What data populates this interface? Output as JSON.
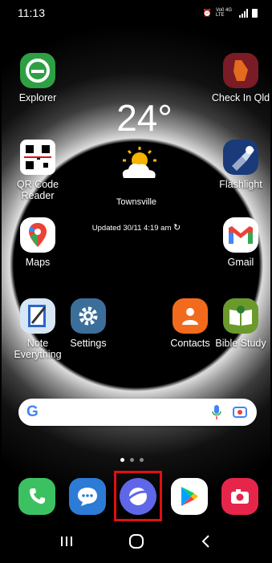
{
  "status": {
    "time": "11:13",
    "network_text": "Vo0 4G LTE"
  },
  "weather": {
    "temperature": "24°",
    "city": "Townsville",
    "updated": "Updated 30/11 4:19 am"
  },
  "apps": {
    "explorer": "Explorer",
    "checkin": "Check In Qld",
    "qr": "QR Code Reader",
    "flashlight": "Flashlight",
    "maps": "Maps",
    "gmail": "Gmail",
    "note": "Note Everything",
    "settings": "Settings",
    "contacts": "Contacts",
    "bible": "Bible Study"
  },
  "dock": [
    "Phone",
    "Messages",
    "Samsung Internet",
    "Play Store",
    "Camera"
  ],
  "search": {
    "logo": "G"
  },
  "pager": {
    "pages": 3,
    "current": 1
  },
  "nav": {
    "recent": "recents-icon",
    "home": "home-icon",
    "back": "back-icon"
  },
  "colors": {
    "highlight": "#e01010"
  }
}
